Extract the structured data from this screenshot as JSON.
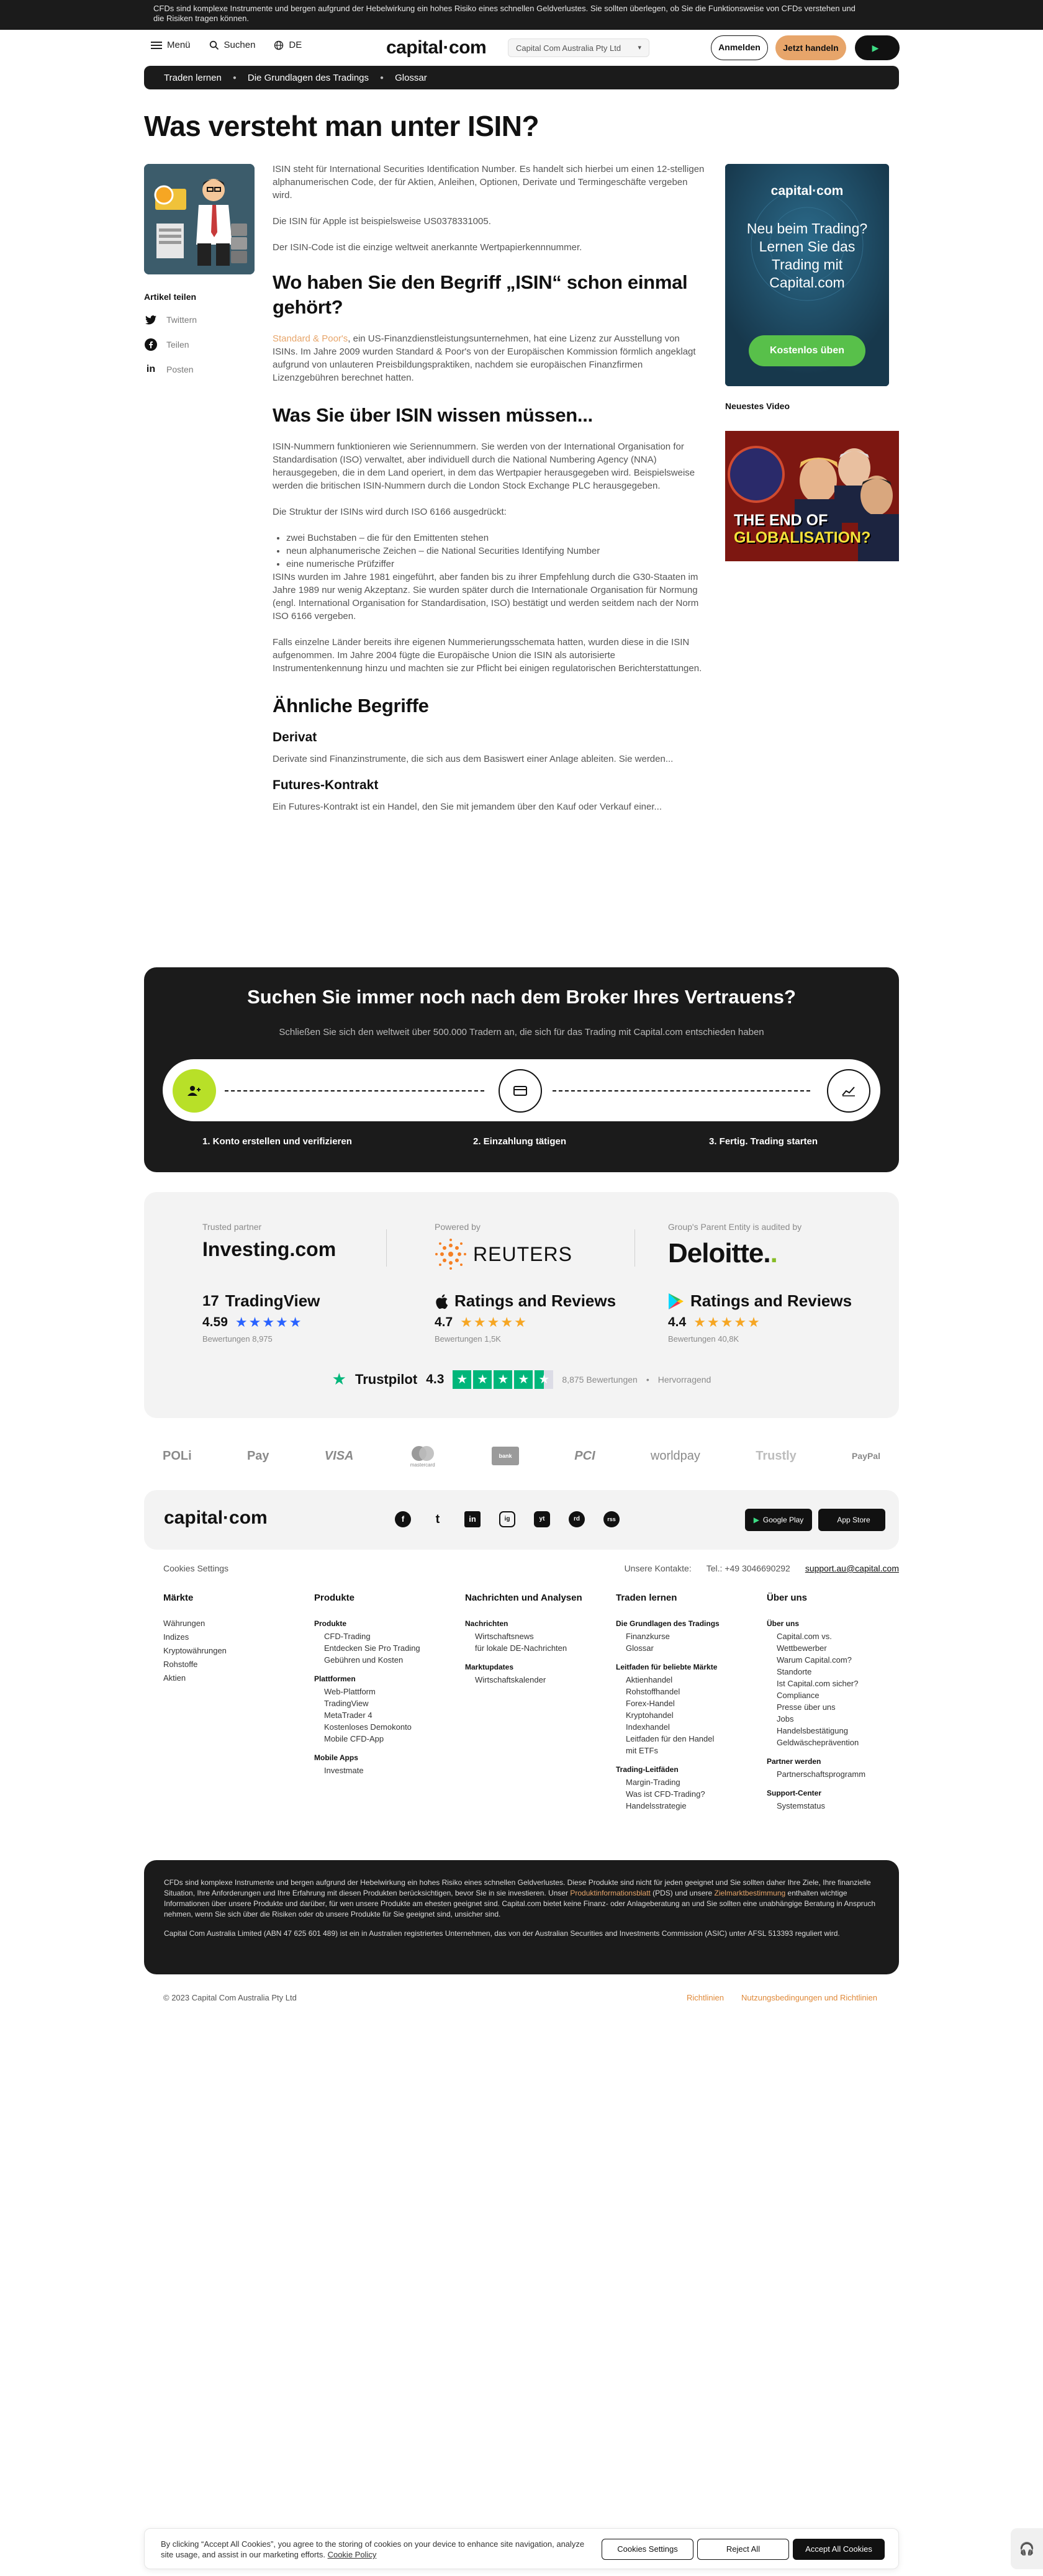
{
  "top_warning": "CFDs sind komplexe Instrumente und bergen aufgrund der Hebelwirkung ein hohes Risiko eines schnellen Geldverlustes. Sie sollten überlegen, ob Sie die Funktionsweise von CFDs verstehen und die Risiken tragen können.",
  "header": {
    "menu_label": "Menü",
    "search_label": "Suchen",
    "language": "DE",
    "logo": "capital·com",
    "entity": "Capital Com Australia Pty Ltd",
    "login": "Anmelden",
    "trade_now": "Jetzt handeln"
  },
  "breadcrumb": [
    "Traden lernen",
    "Die Grundlagen des Tradings",
    "Glossar"
  ],
  "page_title": "Was versteht man unter ISIN?",
  "share": {
    "title": "Artikel teilen",
    "items": [
      "Twittern",
      "Teilen",
      "Posten"
    ]
  },
  "article": {
    "intro": [
      "ISIN steht für International Securities Identification Number. Es handelt sich hierbei um einen 12-stelligen alphanumerischen Code, der für Aktien, Anleihen, Optionen, Derivate und Termingeschäfte vergeben wird.",
      "Die ISIN für Apple ist beispielsweise US0378331005.",
      "Der ISIN-Code ist die einzige weltweit anerkannte Wertpapierkennnummer."
    ],
    "h2_origin": "Wo haben Sie den Begriff „ISIN“ schon einmal gehört?",
    "origin_link": "Standard & Poor's",
    "origin_text": ", ein US-Finanzdienstleistungsunternehmen, hat eine Lizenz zur Ausstellung von ISINs. Im Jahre 2009 wurden Standard & Poor's von der Europäischen Kommission förmlich angeklagt aufgrund von unlauteren Preisbildungspraktiken, nachdem sie europäischen Finanzfirmen Lizenzgebühren berechnet hatten.",
    "h2_know": "Was Sie über ISIN wissen müssen...",
    "know_p1": "ISIN-Nummern funktionieren wie Seriennummern. Sie werden von der International Organisation for Standardisation (ISO) verwaltet, aber individuell durch die National Numbering Agency (NNA) herausgegeben, die in dem Land operiert, in dem das Wertpapier herausgegeben wird. Beispielsweise werden die britischen ISIN-Nummern durch die London Stock Exchange PLC herausgegeben.",
    "know_p2": "Die Struktur der ISINs wird durch ISO 6166 ausgedrückt:",
    "know_list": [
      "zwei Buchstaben – die für den Emittenten stehen",
      "neun alphanumerische Zeichen – die National Securities Identifying Number",
      "eine numerische Prüfziffer"
    ],
    "know_p3": "ISINs wurden im Jahre 1981 eingeführt, aber fanden bis zu ihrer Empfehlung durch die G30-Staaten im Jahre 1989 nur wenig Akzeptanz. Sie wurden später durch die Internationale Organisation für Normung (engl. International Organisation for Standardisation, ISO) bestätigt und werden seitdem nach der Norm ISO 6166 vergeben.",
    "know_p4": "Falls einzelne Länder bereits ihre eigenen Nummerierungsschemata hatten, wurden diese in die ISIN aufgenommen. Im Jahre 2004 fügte die Europäische Union die ISIN als autorisierte Instrumentenkennung hinzu und machten sie zur Pflicht bei einigen regulatorischen Berichterstattungen.",
    "h2_related": "Ähnliche Begriffe",
    "related": [
      {
        "title": "Derivat",
        "text": "Derivate sind Finanzinstrumente, die sich aus dem Basiswert einer Anlage ableiten. Sie werden..."
      },
      {
        "title": "Futures-Kontrakt",
        "text": "Ein Futures-Kontrakt ist ein Handel, den Sie mit jemandem über den Kauf oder Verkauf einer..."
      }
    ]
  },
  "sidebar": {
    "promo_logo": "capital·com",
    "promo_text": "Neu beim Trading? Lernen Sie das Trading mit Capital.com",
    "promo_button": "Kostenlos üben",
    "video_title": "Neuestes Video",
    "video_caption_1": "THE END OF",
    "video_caption_2": "GLOBALISATION?"
  },
  "cta": {
    "title": "Suchen Sie immer noch nach dem Broker Ihres Vertrauens?",
    "subtitle": "Schließen Sie sich den weltweit über 500.000 Tradern an, die sich für das Trading mit Capital.com entschieden haben",
    "steps": [
      "1. Konto erstellen und verifizieren",
      "2. Einzahlung tätigen",
      "3. Fertig. Trading starten"
    ]
  },
  "trust": {
    "partner_caption": "Trusted partner",
    "partner_name": "Investing.com",
    "powered_caption": "Powered by",
    "powered_name": "REUTERS",
    "audit_caption": "Group's Parent Entity is audited by",
    "audit_name": "Deloitte.",
    "ratings": [
      {
        "name": "TradingView",
        "score": "4.59",
        "count": "Bewertungen 8,975",
        "stars": "★★★★★"
      },
      {
        "name": "Ratings and Reviews",
        "score": "4.7",
        "count": "Bewertungen 1,5K",
        "stars": "★★★★★"
      },
      {
        "name": "Ratings and Reviews",
        "score": "4.4",
        "count": "Bewertungen 40,8K",
        "stars": "★★★★★"
      }
    ],
    "trustpilot_name": "Trustpilot",
    "trustpilot_score": "4.3",
    "trustpilot_count": "8,875 Bewertungen",
    "trustpilot_label": "Hervorragend"
  },
  "payments": [
    "POLi",
    "Pay",
    "VISA",
    "mastercard",
    "bank",
    "PCI",
    "worldpay",
    "Trustly",
    "PayPal"
  ],
  "footer_band": {
    "logo": "capital·com",
    "socials": [
      "f",
      "t",
      "in",
      "ig",
      "yt",
      "rd",
      "rss"
    ],
    "google_play": "Google Play",
    "app_store": "App Store"
  },
  "footer_meta": {
    "cookies": "Cookies Settings",
    "contacts_label": "Unsere Kontakte:",
    "phone": "Tel.: +49 3046690292",
    "email": "support.au@capital.com"
  },
  "footer_columns": {
    "markets": {
      "title": "Märkte",
      "items": [
        "Währungen",
        "Indizes",
        "Kryptowährungen",
        "Rohstoffe",
        "Aktien"
      ]
    },
    "products": {
      "title": "Produkte",
      "sub1": "Produkte",
      "sub1_items": [
        "CFD-Trading",
        "Entdecken Sie Pro Trading",
        "Gebühren und Kosten"
      ],
      "sub2": "Plattformen",
      "sub2_items": [
        "Web-Plattform",
        "TradingView",
        "MetaTrader 4",
        "Kostenloses Demokonto",
        "Mobile CFD-App"
      ],
      "sub3": "Mobile Apps",
      "sub3_items": [
        "Investmate"
      ]
    },
    "news": {
      "title": "Nachrichten und Analysen",
      "sub1": "Nachrichten",
      "sub1_items": [
        "Wirtschaftsnews",
        "für lokale DE-Nachrichten"
      ],
      "sub2": "Marktupdates",
      "sub2_items": [
        "Wirtschaftskalender"
      ]
    },
    "learn": {
      "title": "Traden lernen",
      "sub1": "Die Grundlagen des Tradings",
      "sub1_items": [
        "Finanzkurse",
        "Glossar"
      ],
      "sub2": "Leitfaden für beliebte Märkte",
      "sub2_items": [
        "Aktienhandel",
        "Rohstoffhandel",
        "Forex-Handel",
        "Kryptohandel",
        "Indexhandel",
        "Leitfaden für den Handel mit ETFs"
      ],
      "sub3": "Trading-Leitfäden",
      "sub3_items": [
        "Margin-Trading",
        "Was ist CFD-Trading?",
        "Handelsstrategie"
      ]
    },
    "about": {
      "title": "Über uns",
      "sub1": "Über uns",
      "sub1_items": [
        "Capital.com vs. Wettbewerber",
        "Warum Capital.com?",
        "Standorte",
        "Ist Capital.com sicher?",
        "Compliance",
        "Presse über uns",
        "Jobs",
        "Handelsbestätigung",
        "Geldwäscheprävention"
      ],
      "sub2": "Partner werden",
      "sub2_items": [
        "Partnerschaftsprogramm"
      ],
      "sub3": "Support-Center",
      "sub3_items": [
        "Systemstatus"
      ]
    }
  },
  "disclaimer": {
    "p1_a": "CFDs sind komplexe Instrumente und bergen aufgrund der Hebelwirkung ein hohes Risiko eines schnellen Geldverlustes. Diese Produkte sind nicht für jeden geeignet und Sie sollten daher Ihre Ziele, Ihre finanzielle Situation, Ihre Anforderungen und Ihre Erfahrung mit diesen Produkten berücksichtigen, bevor Sie in sie investieren. Unser ",
    "p1_link1": "Produktinformationsblatt",
    "p1_b": " (PDS) und unsere ",
    "p1_link2": "Zielmarktbestimmung",
    "p1_c": " enthalten wichtige Informationen über unsere Produkte und darüber, für wen unsere Produkte am ehesten geeignet sind. Capital.com bietet keine Finanz- oder Anlageberatung an und Sie sollten eine unabhängige Beratung in Anspruch nehmen, wenn Sie sich über die Risiken oder ob unsere Produkte für Sie geeignet sind, unsicher sind.",
    "p2": "Capital Com Australia Limited (ABN 47 625 601 489) ist ein in Australien registriertes Unternehmen, das von der Australian Securities and Investments Commission (ASIC) unter AFSL 513393 reguliert wird."
  },
  "copyright": "© 2023 Capital Com Australia Pty Ltd",
  "legal_links": [
    "Richtlinien",
    "Nutzungsbedingungen und Richtlinien"
  ],
  "cookie": {
    "text_a": "By clicking “Accept All Cookies”, you agree to the storing of cookies on your device to enhance site navigation, analyze site usage, and assist in our marketing efforts. ",
    "policy_link": "Cookie Policy",
    "settings": "Cookies Settings",
    "reject": "Reject All",
    "accept": "Accept All Cookies"
  }
}
